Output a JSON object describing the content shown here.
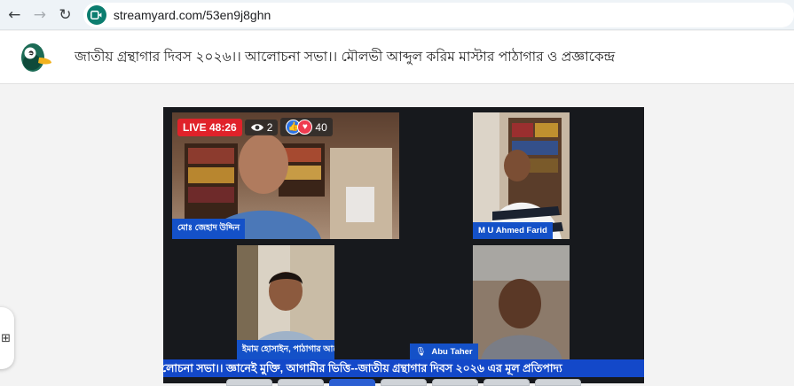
{
  "browser": {
    "url": "streamyard.com/53en9j8ghn",
    "back_icon": "←",
    "forward_icon": "→",
    "reload_icon": "↻"
  },
  "header": {
    "title": "জাতীয় গ্রন্থাগার দিবস ২০২৬।। আলোচনা সভা।। মৌলভী আব্দুল করিম মাস্টার পাঠাগার ও প্রজ্ঞাকেন্দ্র"
  },
  "stream": {
    "live_label": "LIVE 48:26",
    "viewers": "2",
    "reactions": "40",
    "ticker": "লোচনা সভা।। জ্ঞানেই মুক্তি, আগামীর ভিত্তি--জাতীয় গ্রন্থাগার দিবস ২০২৬ এর মূল প্রতিপাদ্য"
  },
  "participants": [
    {
      "name": "মোঃ জেহাদ উদ্দিন"
    },
    {
      "name": "M U Ahmed Farid"
    },
    {
      "name": "ইমাম হোসাইন, পাঠাগার আন্দোলন"
    },
    {
      "name": "Abu Taher"
    }
  ],
  "colors": {
    "accent": "#1451c8",
    "live": "#e0222a",
    "stage": "#17191d"
  }
}
